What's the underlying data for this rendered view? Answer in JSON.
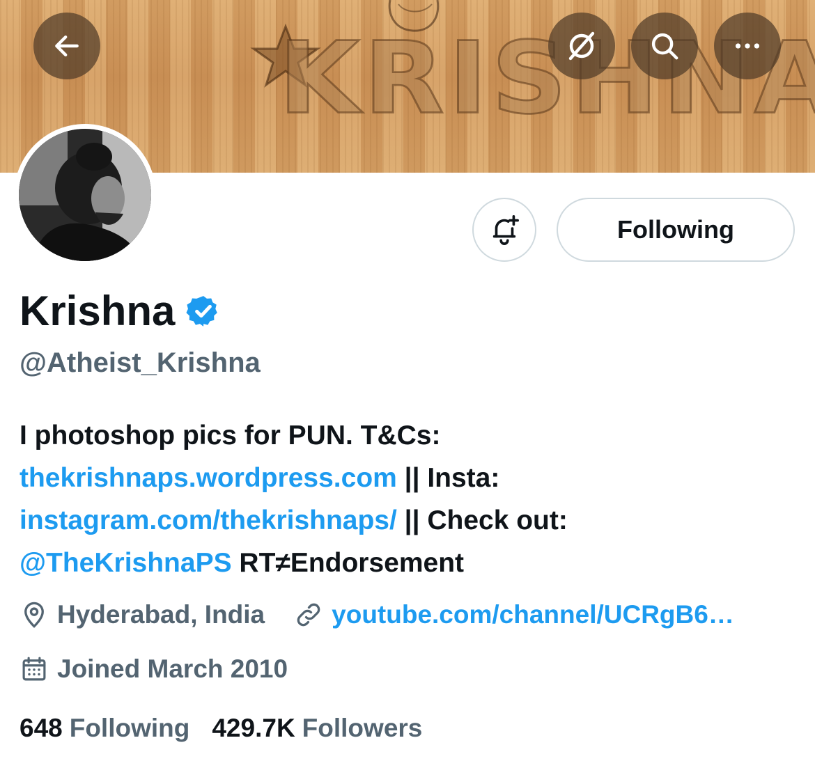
{
  "header": {
    "banner_text": "KRISHNA",
    "back_icon": "arrow-left-icon",
    "grok_icon": "grok-icon",
    "search_icon": "search-icon",
    "more_icon": "more-horizontal-icon"
  },
  "profile": {
    "display_name": "Krishna",
    "verified_icon": "verified-badge-icon",
    "handle": "@Atheist_Krishna",
    "notify_icon": "bell-plus-icon",
    "follow_button_label": "Following"
  },
  "bio": {
    "line1_text": "I photoshop pics for PUN. T&Cs:",
    "link1": "thekrishnaps.wordpress.com",
    "sep1": " || Insta:",
    "link2": "instagram.com/thekrishnaps/",
    "sep2": " || Check out:",
    "mention": "@TheKrishnaPS",
    "tail": " RT≠Endorsement"
  },
  "meta": {
    "location": "Hyderabad, India",
    "website": "youtube.com/channel/UCRgB6…",
    "joined": "Joined March 2010"
  },
  "stats": {
    "following_count": "648",
    "following_label": "Following",
    "followers_count": "429.7K",
    "followers_label": "Followers"
  },
  "colors": {
    "accent": "#1d9bf0",
    "text_primary": "#0f1419",
    "text_secondary": "#536471",
    "border": "#cfd9de"
  }
}
